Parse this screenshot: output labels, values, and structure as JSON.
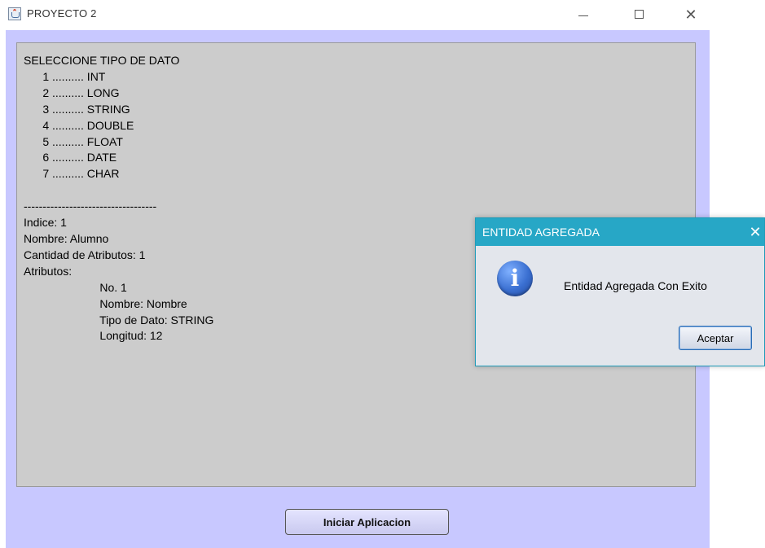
{
  "window": {
    "title": "PROYECTO 2",
    "controls": {
      "minimize": "—",
      "maximize": "☐",
      "close": "✕"
    }
  },
  "output": {
    "lines": [
      "SELECCIONE TIPO DE DATO",
      "      1 .......... INT",
      "      2 .......... LONG",
      "      3 .......... STRING",
      "      4 .......... DOUBLE",
      "      5 .......... FLOAT",
      "      6 .......... DATE",
      "      7 .......... CHAR",
      "",
      "-----------------------------------",
      "Indice: 1",
      "Nombre: Alumno",
      "Cantidad de Atributos: 1",
      "Atributos:",
      "                        No. 1",
      "                        Nombre: Nombre",
      "                        Tipo de Dato: STRING",
      "                        Longitud: 12"
    ]
  },
  "start_button": {
    "label": "Iniciar Aplicacion"
  },
  "dialog": {
    "title": "ENTIDAD AGREGADA",
    "close": "✕",
    "icon": "info-icon",
    "icon_glyph": "i",
    "message": "Entidad Agregada Con Exito",
    "accept_label": "Aceptar"
  },
  "colors": {
    "client_background": "#c8c8ff",
    "output_background": "#cccccc",
    "dialog_titlebar": "#27a7c6"
  }
}
